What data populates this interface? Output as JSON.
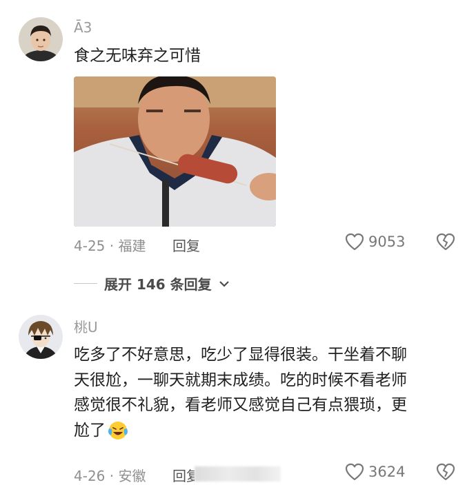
{
  "comments": [
    {
      "username": "Ā3",
      "text_lines": [
        "食之无味弃之可惜"
      ],
      "date_location": "4-25 · 福建",
      "reply_label": "回复",
      "likes": "9053",
      "avatar_icon": "child-avatar",
      "image_icon": "boy-eating-sausage-photo"
    },
    {
      "username": "桃U",
      "text_lines": [
        "吃多了不好意思，吃少了显得很装。干坐着不聊",
        "天很尬，一聊天就期末成绩。吃的时候不看老师",
        "感觉很不礼貌，看老师又感觉自己有点猥琐，更",
        "尬了"
      ],
      "emoji_icon": "laughing-crying-emoji",
      "date_location": "4-26 · 安徽",
      "reply_label": "回复",
      "likes": "3624",
      "avatar_icon": "anime-avatar"
    }
  ],
  "expand_replies": {
    "label": "展开 146 条回复"
  },
  "colors": {
    "meta_gray": "#8f8f8f",
    "text": "#1f1f1f",
    "icon_gray": "#777777"
  }
}
